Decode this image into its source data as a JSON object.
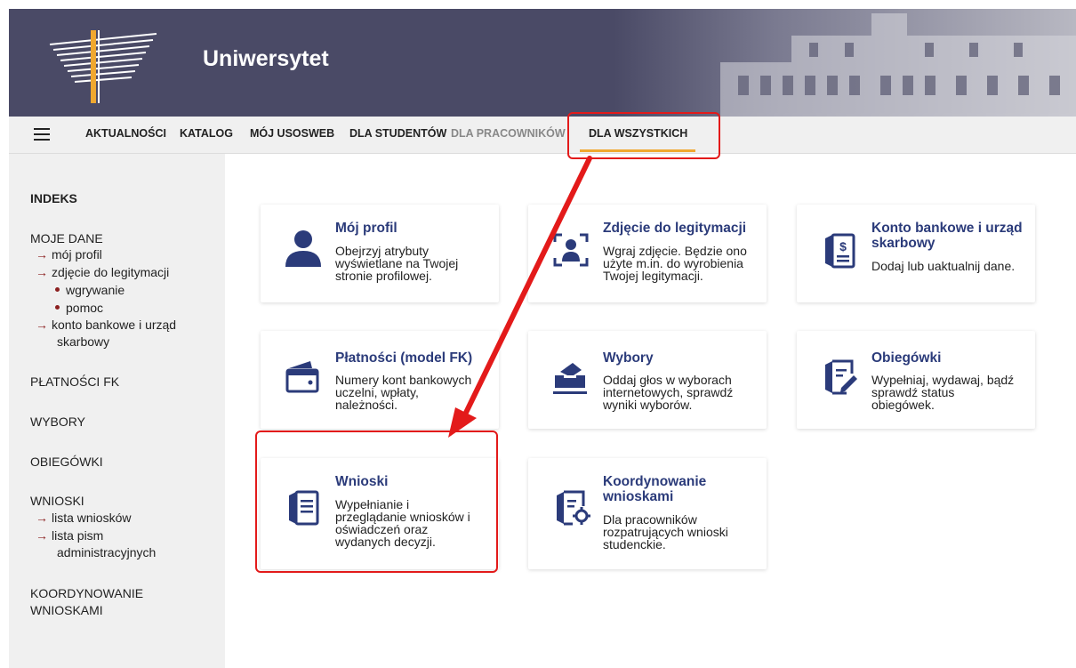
{
  "header": {
    "title": "Uniwersytet"
  },
  "nav": {
    "items": [
      {
        "label": "AKTUALNOŚCI"
      },
      {
        "label": "KATALOG"
      },
      {
        "label": "MÓJ USOSWEB"
      },
      {
        "label": "DLA STUDENTÓW"
      },
      {
        "label": "DLA PRACOWNIKÓW"
      },
      {
        "label": "DLA WSZYSTKICH"
      }
    ],
    "active": "DLA WSZYSTKICH"
  },
  "sidebar": {
    "indeks": "INDEKS",
    "moje_dane": "MOJE DANE",
    "moj_profil": "mój profil",
    "zdjecie": "zdjęcie do legitymacji",
    "wgrywanie": "wgrywanie",
    "pomoc": "pomoc",
    "konto_1": "konto bankowe i urząd",
    "konto_2": "skarbowy",
    "platnosci": "PŁATNOŚCI FK",
    "wybory": "WYBORY",
    "obiegowki": "OBIEGÓWKI",
    "wnioski": "WNIOSKI",
    "lista_wnioskow": "lista wniosków",
    "lista_pism_1": "lista pism",
    "lista_pism_2": "administracyjnych",
    "koord_1": "KOORDYNOWANIE",
    "koord_2": "WNIOSKAMI"
  },
  "cards": {
    "profil": {
      "title": "Mój profil",
      "desc": [
        "Obejrzyj atrybuty",
        "wyświetlane na Twojej",
        "stronie profilowej."
      ],
      "icon": "user-icon"
    },
    "zdjecie": {
      "title": "Zdjęcie do legitymacji",
      "desc": [
        "Wgraj zdjęcie. Będzie ono",
        "użyte m.in. do wyrobienia",
        "Twojej legitymacji."
      ],
      "icon": "id-photo-icon"
    },
    "konto": {
      "title": [
        "Konto bankowe i urząd",
        "skarbowy"
      ],
      "desc": [
        "Dodaj lub uaktualnij dane."
      ],
      "icon": "bank-document-icon"
    },
    "platnosci": {
      "title": "Płatności (model FK)",
      "desc": [
        "Numery kont bankowych",
        "uczelni, wpłaty,",
        "należności."
      ],
      "icon": "wallet-icon"
    },
    "wybory": {
      "title": "Wybory",
      "desc": [
        "Oddaj głos w wyborach",
        "internetowych, sprawdź",
        "wyniki wyborów."
      ],
      "icon": "ballot-box-icon"
    },
    "obiegowki": {
      "title": "Obiegówki",
      "desc": [
        "Wypełniaj, wydawaj, bądź",
        "sprawdź status",
        "obiegówek."
      ],
      "icon": "form-edit-icon"
    },
    "wnioski": {
      "title": "Wnioski",
      "desc": [
        "Wypełnianie i",
        "przeglądanie wniosków i",
        "oświadczeń oraz",
        "wydanych decyzji."
      ],
      "icon": "document-icon"
    },
    "koord": {
      "title": [
        "Koordynowanie",
        "wnioskami"
      ],
      "desc": [
        "Dla pracowników",
        "rozpatrujących wnioski",
        "studenckie."
      ],
      "icon": "document-gear-icon"
    }
  },
  "colors": {
    "accent": "#2b3b7a",
    "header": "#4a4a66",
    "nav_active_underline": "#f0a830",
    "annotation": "#e31a1a",
    "bullet": "#8b1f1f"
  }
}
